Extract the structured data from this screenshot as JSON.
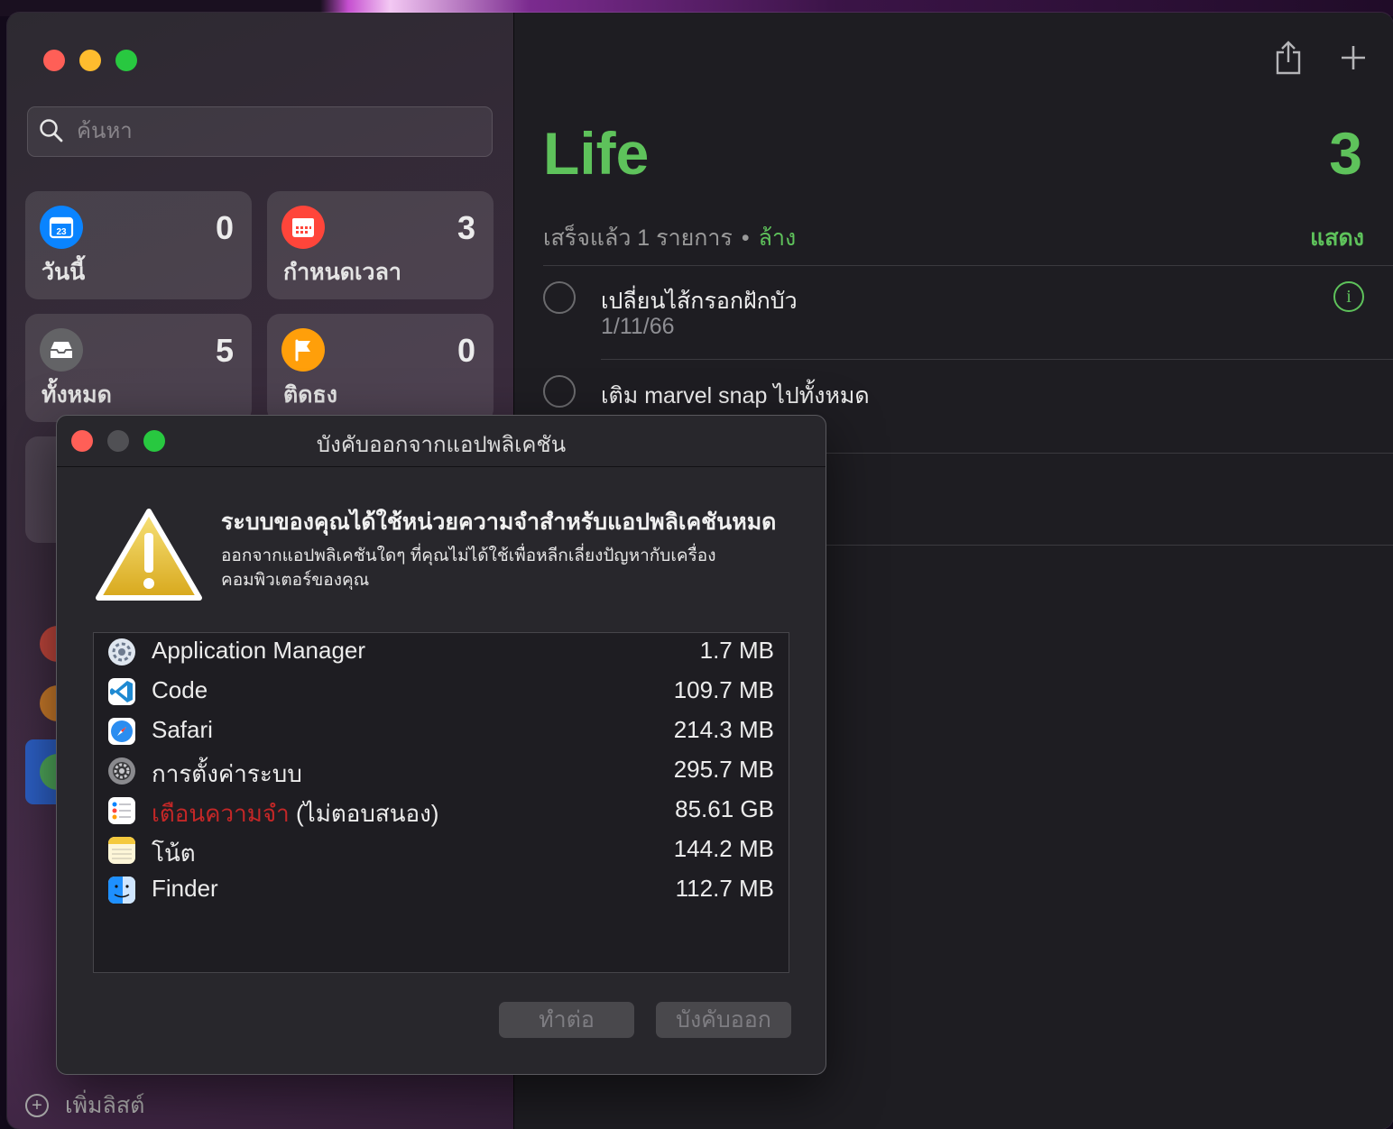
{
  "sidebar": {
    "search_placeholder": "ค้นหา",
    "smart_lists": [
      {
        "label": "วันนี้",
        "count": "0",
        "icon": "calendar-today-icon",
        "icon_text": "23",
        "color": "#0a84ff"
      },
      {
        "label": "กำหนดเวลา",
        "count": "3",
        "icon": "calendar-scheduled-icon",
        "color": "#ff453a"
      },
      {
        "label": "ทั้งหมด",
        "count": "5",
        "icon": "tray-icon",
        "color": "#636366"
      },
      {
        "label": "ติดธง",
        "count": "0",
        "icon": "flag-icon",
        "color": "#ff9f0a"
      }
    ],
    "add_list_label": "เพิ่มลิสต์"
  },
  "main": {
    "list_title": "Life",
    "list_count": "3",
    "completed_text": "เสร็จแล้ว 1 รายการ",
    "separator": "•",
    "clear_label": "ล้าง",
    "show_label": "แสดง",
    "tasks": [
      {
        "title": "เปลี่ยนไส้กรอกฝักบัว",
        "subtitle": "1/11/66",
        "info_icon": "i"
      },
      {
        "title": "เติม marvel snap ไปทั้งหมด"
      }
    ],
    "accent_color": "#5ec25b"
  },
  "dialog": {
    "title": "บังคับออกจากแอปพลิเคชัน",
    "heading": "ระบบของคุณได้ใช้หน่วยความจำสำหรับแอปพลิเคชันหมด",
    "message": "ออกจากแอปพลิเคชันใดๆ ที่คุณไม่ได้ใช้เพื่อหลีกเลี่ยงปัญหากับเครื่องคอมพิวเตอร์ของคุณ",
    "apps": [
      {
        "name": "Application Manager",
        "size": "1.7 MB",
        "icon": "application-manager-icon"
      },
      {
        "name": "Code",
        "size": "109.7 MB",
        "icon": "vscode-icon"
      },
      {
        "name": "Safari",
        "size": "214.3 MB",
        "icon": "safari-icon"
      },
      {
        "name": "การตั้งค่าระบบ",
        "size": "295.7 MB",
        "icon": "system-settings-icon"
      },
      {
        "name": "เตือนความจำ",
        "status": "(ไม่ตอบสนอง)",
        "size": "85.61 GB",
        "icon": "reminders-icon"
      },
      {
        "name": "โน้ต",
        "size": "144.2 MB",
        "icon": "notes-icon"
      },
      {
        "name": "Finder",
        "size": "112.7 MB",
        "icon": "finder-icon"
      }
    ],
    "continue_label": "ทำต่อ",
    "force_quit_label": "บังคับออก",
    "not_responding_color": "#c42727"
  }
}
